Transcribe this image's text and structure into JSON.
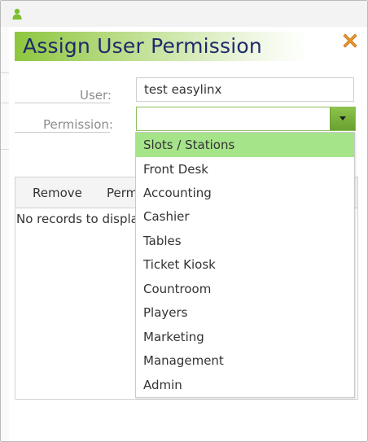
{
  "dialog": {
    "title": "Assign User Permission"
  },
  "form": {
    "user_label": "User:",
    "user_value": "test easylinx",
    "permission_label": "Permission:",
    "permission_value": ""
  },
  "grid": {
    "columns": [
      "Remove",
      "Perm"
    ],
    "empty_message": "No records to display"
  },
  "dropdown": {
    "options": [
      "Slots / Stations",
      "Front Desk",
      "Accounting",
      "Cashier",
      "Tables",
      "Ticket Kiosk",
      "Countroom",
      "Players",
      "Marketing",
      "Management",
      "Admin"
    ],
    "highlighted": "Slots / Stations"
  },
  "icons": {
    "titlebar": "user-icon",
    "close": "close-icon",
    "dropdown_arrow": "chevron-down-icon"
  },
  "colors": {
    "accent_green": "#8dc63f",
    "title_text": "#1f2a6b",
    "highlight": "#a6e48a",
    "close_orange": "#e8962a"
  }
}
